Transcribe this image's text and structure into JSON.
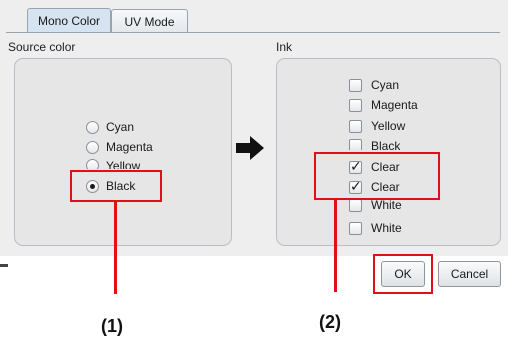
{
  "tabs": [
    {
      "label": "Mono Color",
      "active": true
    },
    {
      "label": "UV Mode",
      "active": false
    }
  ],
  "source_group": {
    "label": "Source color",
    "options": [
      {
        "label": "Cyan",
        "selected": false
      },
      {
        "label": "Magenta",
        "selected": false
      },
      {
        "label": "Yellow",
        "selected": false
      },
      {
        "label": "Black",
        "selected": true
      }
    ]
  },
  "ink_group": {
    "label": "Ink",
    "options": [
      {
        "label": "Cyan",
        "checked": false
      },
      {
        "label": "Magenta",
        "checked": false
      },
      {
        "label": "Yellow",
        "checked": false
      },
      {
        "label": "Black",
        "checked": false
      },
      {
        "label": "Clear",
        "checked": true
      },
      {
        "label": "Clear",
        "checked": true
      },
      {
        "label": "White",
        "checked": false
      },
      {
        "label": "White",
        "checked": false
      }
    ]
  },
  "buttons": {
    "ok": "OK",
    "cancel": "Cancel"
  },
  "callouts": {
    "one": "(1)",
    "two": "(2)"
  },
  "icons": {
    "arrow": "arrow-right-icon"
  },
  "colors": {
    "highlight": "#e0101a",
    "active_tab": "#d6e4f2"
  }
}
